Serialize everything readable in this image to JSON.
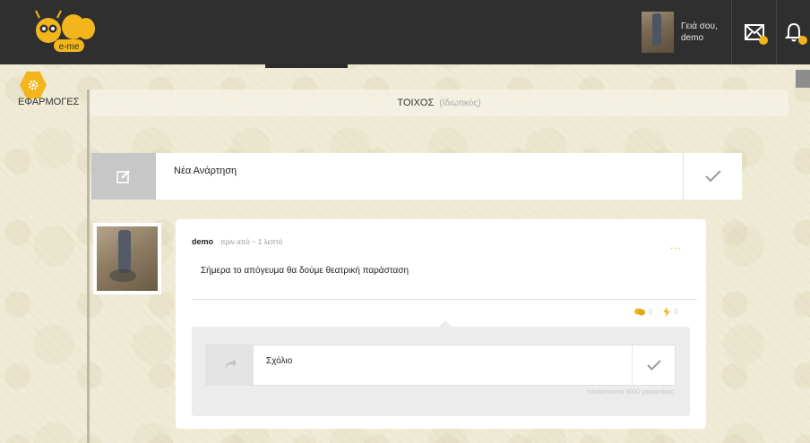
{
  "header": {
    "logo_text": "e-me",
    "user": {
      "greeting_line1": "Γειά σου,",
      "greeting_line2": "demo"
    },
    "icons": {
      "mail": "mail-icon",
      "bell": "bell-icon"
    }
  },
  "sidebar": {
    "apps_label": "ΕΦΑΡΜΟΓΕΣ",
    "gear_icon": "gear-icon"
  },
  "wall": {
    "title": "ΤΟΙΧΟΣ",
    "subtitle": "(Ιδιωτικός)"
  },
  "new_post": {
    "label": "Νέα Ανάρτηση",
    "edit_icon": "edit-icon",
    "submit_icon": "check-icon"
  },
  "post": {
    "author": "demo",
    "time": "πριν από ~ 1 λεπτό",
    "text": "Σήμερα το απόγευμα θα δούμε θεατρική παράσταση",
    "menu": "...",
    "comments_count": "0",
    "likes_count": "0",
    "comment": {
      "placeholder": "Σχόλιο",
      "remaining": "Υπολείπονται 5000 χαρακτήρες",
      "reply_icon": "reply-icon",
      "submit_icon": "check-icon"
    }
  },
  "colors": {
    "accent": "#f2b51c",
    "topbar": "#2f2f2f",
    "background": "#efebd6"
  }
}
